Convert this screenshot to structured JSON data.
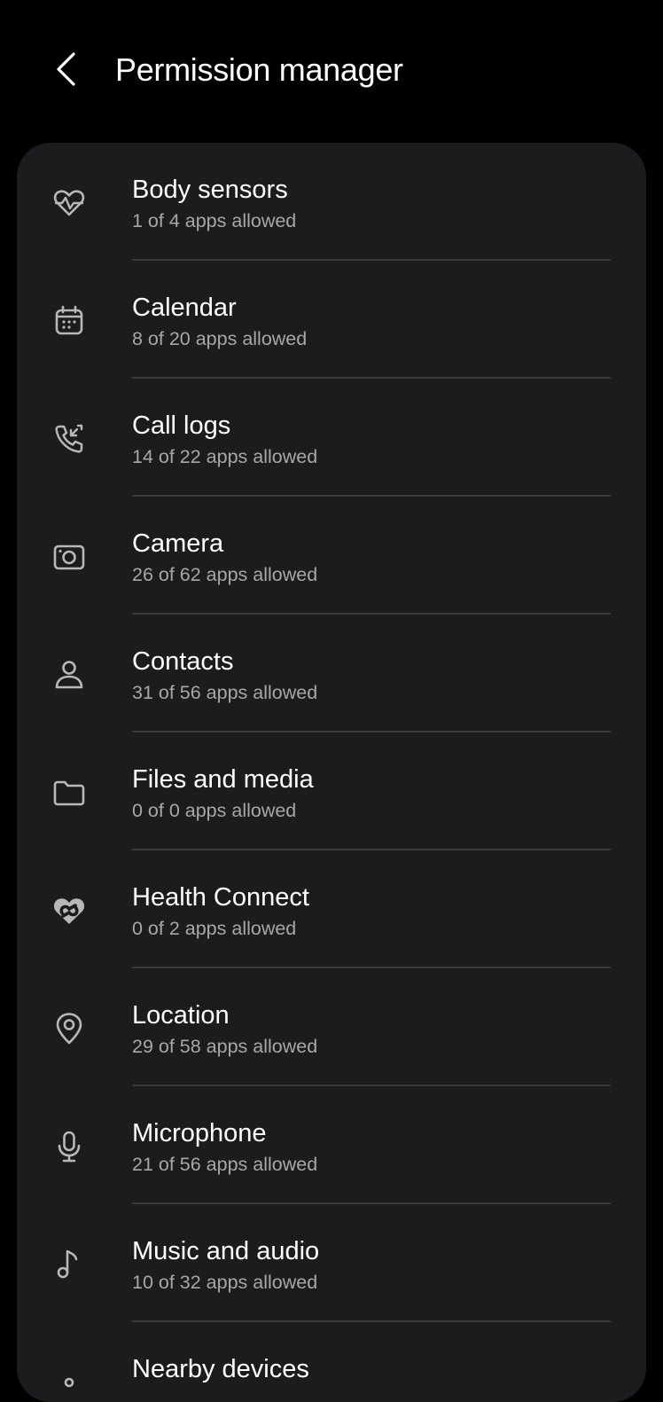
{
  "header": {
    "title": "Permission manager"
  },
  "permissions": [
    {
      "label": "Body sensors",
      "status": "1 of 4 apps allowed",
      "icon": "heart-pulse-icon"
    },
    {
      "label": "Calendar",
      "status": "8 of 20 apps allowed",
      "icon": "calendar-icon"
    },
    {
      "label": "Call logs",
      "status": "14 of 22 apps allowed",
      "icon": "phone-call-log-icon"
    },
    {
      "label": "Camera",
      "status": "26 of 62 apps allowed",
      "icon": "camera-icon"
    },
    {
      "label": "Contacts",
      "status": "31 of 56 apps allowed",
      "icon": "person-icon"
    },
    {
      "label": "Files and media",
      "status": "0 of 0 apps allowed",
      "icon": "folder-icon"
    },
    {
      "label": "Health Connect",
      "status": "0 of 2 apps allowed",
      "icon": "health-connect-icon"
    },
    {
      "label": "Location",
      "status": "29 of 58 apps allowed",
      "icon": "location-pin-icon"
    },
    {
      "label": "Microphone",
      "status": "21 of 56 apps allowed",
      "icon": "microphone-icon"
    },
    {
      "label": "Music and audio",
      "status": "10 of 32 apps allowed",
      "icon": "music-note-icon"
    },
    {
      "label": "Nearby devices",
      "status": "",
      "icon": "nearby-devices-icon"
    }
  ]
}
